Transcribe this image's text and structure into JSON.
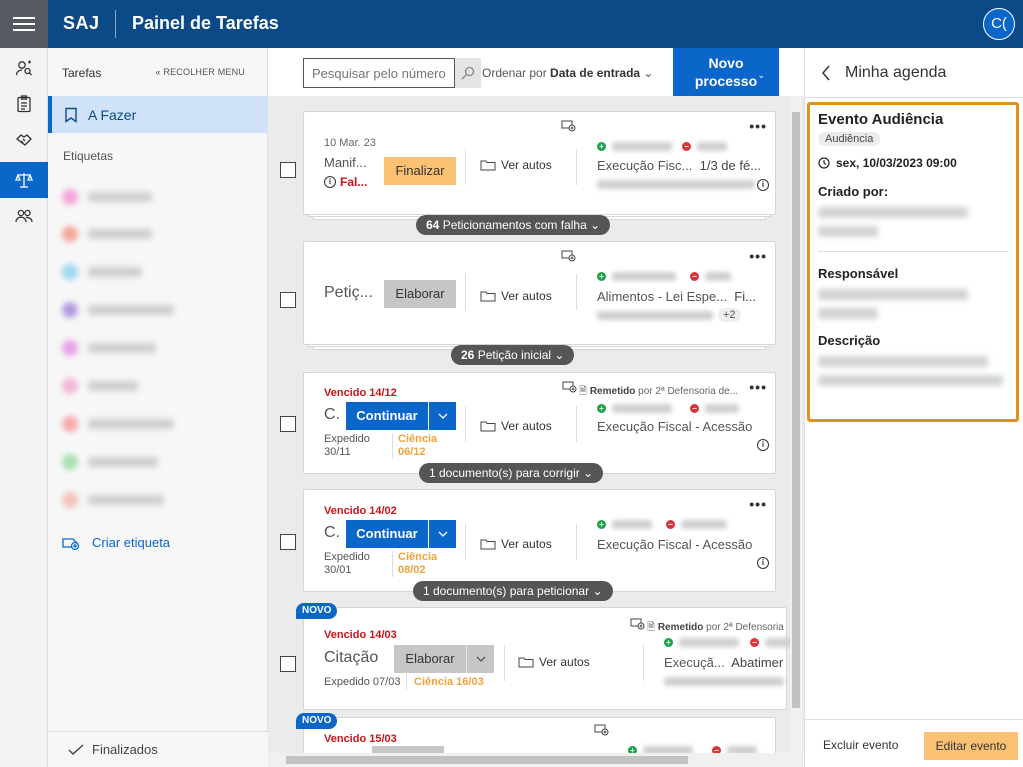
{
  "header": {
    "brand": "SAJ",
    "title": "Painel de Tarefas",
    "avatar": "C(",
    "colors": {
      "primary": "#0b4a87",
      "accent": "#0a66c9",
      "warning": "#fbc173",
      "highlight": "#e58f1c"
    }
  },
  "rail": {
    "icons": [
      "user-search-icon",
      "clipboard-icon",
      "handshake-icon",
      "scales-icon",
      "people-icon"
    ],
    "active": "scales-icon"
  },
  "sidebar": {
    "title": "Tarefas",
    "collapse_label": "RECOLHER MENU",
    "active_item": "A Fazer",
    "labels_heading": "Etiquetas",
    "tag_colors": [
      "#f4a6d8",
      "#f4a79a",
      "#9fd6f0",
      "#b49be3",
      "#e7a3e8",
      "#f5b7d9",
      "#f7a8a8",
      "#a6e0b0",
      "#f3c2b8"
    ],
    "create_tag": "Criar etiqueta",
    "finalized": "Finalizados"
  },
  "toolbar": {
    "search_placeholder": "Pesquisar pelo número",
    "sort_prefix": "Ordenar por",
    "sort_value": "Data de entrada",
    "new_line1": "Novo",
    "new_line2": "processo"
  },
  "tasks": [
    {
      "date": "10 Mar. 23",
      "title": "Manif...",
      "error": "Fal...",
      "action": "Finalizar",
      "ver_autos": "Ver autos",
      "class": "Execução Fisc...",
      "subject": "1/3 de fé...",
      "group_count": "64",
      "group_label": "Peticionamentos com falha"
    },
    {
      "title": "Petiç...",
      "action": "Elaborar",
      "ver_autos": "Ver autos",
      "class": "Alimentos - Lei Espe...",
      "subject": "Fi...",
      "extra": "+2",
      "group_count": "26",
      "group_label": "Petição inicial"
    },
    {
      "date": "Vencido 14/12",
      "title": "C.",
      "action": "Continuar",
      "ver_autos": "Ver autos",
      "expedido_label": "Expedido",
      "expedido_date": "30/11",
      "ciencia_label": "Ciência",
      "ciencia_date": "06/12",
      "remetido_label": "Remetido",
      "remetido_by": "por 2ª Defensoria de...",
      "class": "Execução Fiscal - Acessão",
      "group_label": "1 documento(s) para corrigir"
    },
    {
      "date": "Vencido 14/02",
      "title": "C.",
      "action": "Continuar",
      "ver_autos": "Ver autos",
      "expedido_label": "Expedido",
      "expedido_date": "30/01",
      "ciencia_label": "Ciência",
      "ciencia_date": "08/02",
      "class": "Execução Fiscal - Acessão",
      "group_label": "1 documento(s) para peticionar"
    },
    {
      "badge": "NOVO",
      "date": "Vencido 14/03",
      "title": "Citação",
      "action": "Elaborar",
      "ver_autos": "Ver autos",
      "expedido": "Expedido 07/03",
      "ciencia": "Ciência 16/03",
      "remetido_label": "Remetido",
      "remetido_by": "por 2ª Defensoria",
      "class": "Execuçã...",
      "subject": "Abatimer"
    },
    {
      "badge": "NOVO",
      "date": "Vencido 15/03"
    }
  ],
  "panel": {
    "title": "Minha agenda",
    "event_title": "Evento Audiência",
    "event_type": "Audiência",
    "event_date": "sex, 10/03/2023 09:00",
    "created_by_label": "Criado por:",
    "responsible_label": "Responsável",
    "description_label": "Descrição",
    "delete_label": "Excluir evento",
    "edit_label": "Editar evento"
  }
}
